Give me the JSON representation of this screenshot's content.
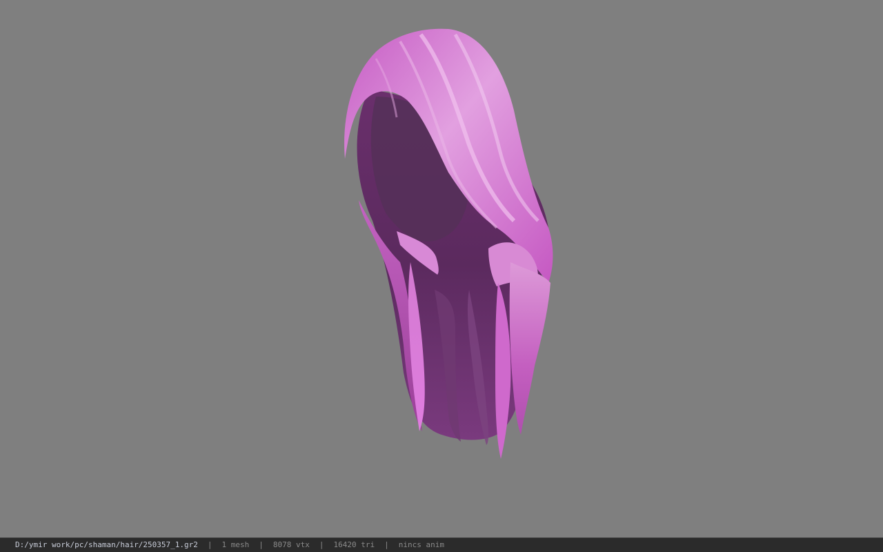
{
  "viewport": {
    "background": "#7f7f7f",
    "model": "hair-mesh",
    "hair_colors": {
      "highlight": "#e9a6e6",
      "base": "#c058c0",
      "shadow": "#5a2a5c"
    }
  },
  "statusbar": {
    "file_path": "D:/ymir work/pc/shaman/hair/250357_1.gr2",
    "mesh_count": "1 mesh",
    "vertex_count": "8078 vtx",
    "triangle_count": "16420 tri",
    "animation": "nincs anim",
    "separator": "|"
  }
}
